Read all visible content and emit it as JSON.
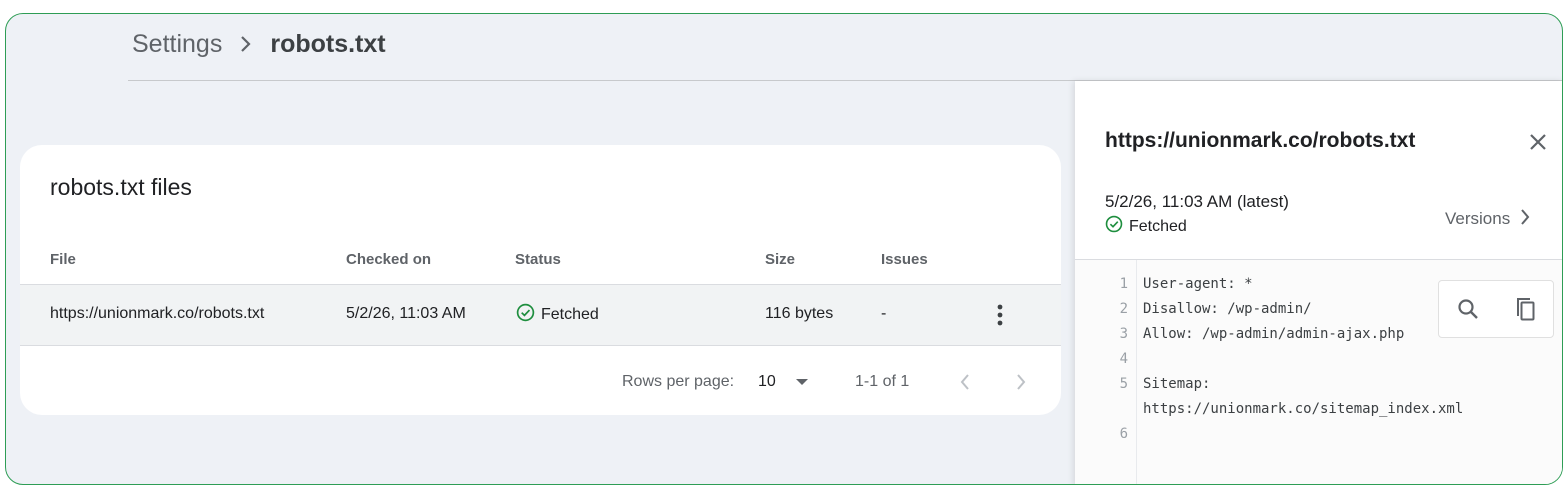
{
  "breadcrumb": {
    "root": "Settings",
    "current": "robots.txt"
  },
  "card": {
    "title": "robots.txt files",
    "columns": {
      "file": "File",
      "checked_on": "Checked on",
      "status": "Status",
      "size": "Size",
      "issues": "Issues"
    },
    "rows": [
      {
        "file": "https://unionmark.co/robots.txt",
        "checked_on": "5/2/26, 11:03 AM",
        "status": "Fetched",
        "size": "116 bytes",
        "issues": "-"
      }
    ],
    "pagination": {
      "rows_per_page_label": "Rows per page:",
      "rows_per_page": "10",
      "range": "1-1 of 1"
    }
  },
  "panel": {
    "title": "https://unionmark.co/robots.txt",
    "version_date": "5/2/26, 11:03 AM (latest)",
    "version_status": "Fetched",
    "versions_label": "Versions",
    "code_lines": [
      {
        "n": "1",
        "text": "User-agent: *"
      },
      {
        "n": "2",
        "text": "Disallow: /wp-admin/"
      },
      {
        "n": "3",
        "text": "Allow: /wp-admin/admin-ajax.php"
      },
      {
        "n": "4",
        "text": ""
      },
      {
        "n": "5",
        "text": "Sitemap:"
      },
      {
        "n": "",
        "text": "https://unionmark.co/sitemap_index.xml"
      },
      {
        "n": "6",
        "text": ""
      }
    ]
  },
  "colors": {
    "success": "#1e8e3e",
    "frame_border": "#2e9d55",
    "background": "#eef1f6"
  },
  "icons": [
    "chevron-right-icon",
    "check-circle-icon",
    "more-vert-icon",
    "dropdown-arrow-icon",
    "chevron-left-icon",
    "close-icon",
    "search-icon",
    "copy-icon"
  ]
}
